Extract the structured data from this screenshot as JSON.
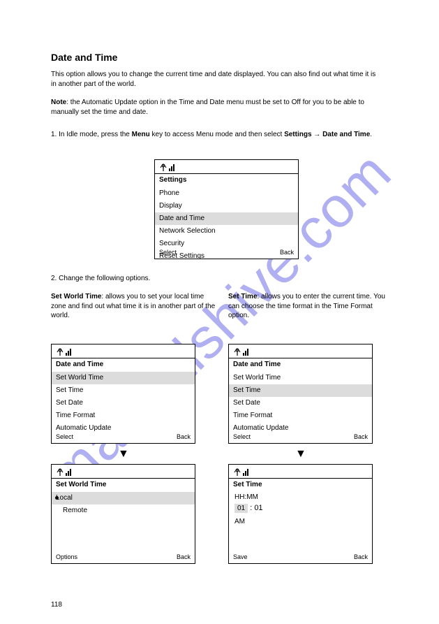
{
  "page_number": "118",
  "watermark": "manualshive.com",
  "section": {
    "heading": "Date and Time",
    "intro": "This option allows you to change the current time and date displayed. You can also find out what time it is in another part of the world.",
    "note_label": "Note",
    "note_text": ": the Automatic Update option in the Time and Date menu must be set to Off for you to be able to manually set the time and date."
  },
  "step1": {
    "text_prefix": "1. In Idle mode, press the ",
    "key": "Menu",
    "text_mid": " key to access Menu mode and then select ",
    "path": "Settings → Date and Time",
    "text_suffix": "."
  },
  "screen1": {
    "title": "Settings",
    "items": [
      "Phone",
      "Display",
      "Date and Time",
      "Network Selection",
      "Security",
      "Reset Settings"
    ],
    "hl_index": 2,
    "soft_left": "Select",
    "soft_right": "Back"
  },
  "step2": {
    "text": "2. Change the following options."
  },
  "option_setwt": {
    "label": "Set World Time",
    "text": ": allows you to set your local time zone and find out what time it is in another part of the world."
  },
  "option_settime": {
    "label": "Set Time",
    "text": ": allows you to enter the current time. You can choose the time format in the Time Format option."
  },
  "screen2": {
    "title": "Date and Time",
    "items": [
      "Set World Time",
      "Set Time",
      "Set Date",
      "Time Format",
      "Automatic Update"
    ],
    "hl_index": 0,
    "soft_left": "Select",
    "soft_right": "Back"
  },
  "screen3": {
    "title": "Date and Time",
    "items": [
      "Set World Time",
      "Set Time",
      "Set Date",
      "Time Format",
      "Automatic Update"
    ],
    "hl_index": 1,
    "soft_left": "Select",
    "soft_right": "Back"
  },
  "screen4": {
    "title": "Set World Time",
    "items": [
      "Local",
      "Remote"
    ],
    "soft_left": "Options",
    "soft_right": "Back"
  },
  "screen5": {
    "title": "Set Time",
    "time_label": "HH:MM",
    "time_value": "01 : 01",
    "ampm": "AM",
    "soft_left": "Save",
    "soft_right": "Back"
  }
}
